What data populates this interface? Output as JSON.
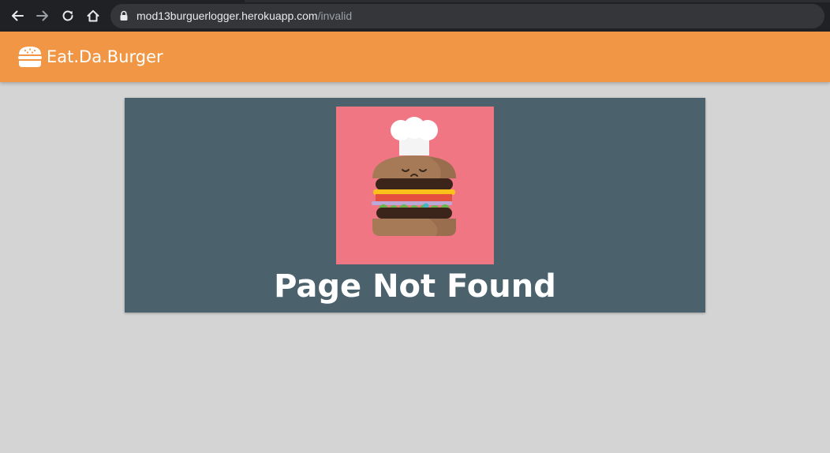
{
  "browser": {
    "url_host": "mod13burguerlogger.herokuapp.com",
    "url_path": "/invalid",
    "icons": [
      "back-arrow-icon",
      "forward-arrow-icon",
      "reload-icon",
      "home-icon",
      "lock-icon"
    ]
  },
  "navbar": {
    "brand_icon": "hamburger-icon",
    "brand_text": "Eat.Da.Burger",
    "background_color": "#f19644"
  },
  "main": {
    "card_color": "#4b626d",
    "illustration": "sad-burger-chef-illustration",
    "title": "Page Not Found"
  }
}
